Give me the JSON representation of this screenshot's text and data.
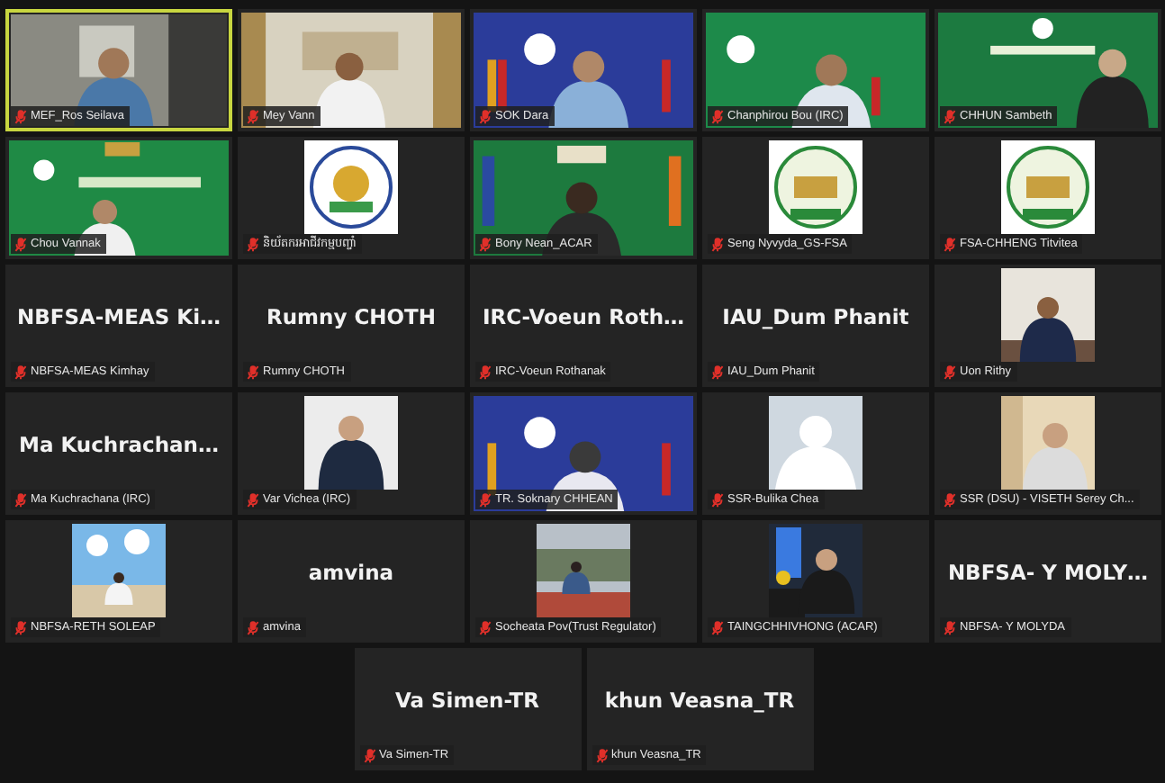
{
  "tiles": [
    {
      "kind": "video",
      "name": "MEF_Ros Seilava",
      "speaking": true,
      "muted": true
    },
    {
      "kind": "video",
      "name": "Mey Vann",
      "speaking": false,
      "muted": true
    },
    {
      "kind": "video",
      "name": "SOK Dara",
      "speaking": false,
      "muted": true
    },
    {
      "kind": "video",
      "name": "Chanphirou Bou (IRC)",
      "speaking": false,
      "muted": true
    },
    {
      "kind": "video",
      "name": "CHHUN Sambeth",
      "speaking": false,
      "muted": true
    },
    {
      "kind": "video",
      "name": "Chou Vannak",
      "speaking": false,
      "muted": true
    },
    {
      "name": "និយ័តករអាជីវកម្មបញ្ចាំ",
      "speaking": false,
      "muted": true
    },
    {
      "kind": "video",
      "name": "Bony Nean_ACAR",
      "speaking": false,
      "muted": true
    },
    {
      "name": "Seng Nyvyda_GS-FSA",
      "speaking": false,
      "muted": true
    },
    {
      "name": "FSA-CHHENG Titvitea",
      "speaking": false,
      "muted": true
    },
    {
      "kind": "name",
      "display_name": "NBFSA-MEAS  Ki…",
      "name": "NBFSA-MEAS Kimhay",
      "speaking": false,
      "muted": true
    },
    {
      "kind": "name",
      "display_name": "Rumny CHOTH",
      "name": "Rumny CHOTH",
      "speaking": false,
      "muted": true
    },
    {
      "kind": "name",
      "display_name": "IRC-Voeun  Roth…",
      "name": "IRC-Voeun Rothanak",
      "speaking": false,
      "muted": true
    },
    {
      "kind": "name",
      "display_name": "IAU_Dum Phanit",
      "name": "IAU_Dum Phanit",
      "speaking": false,
      "muted": true
    },
    {
      "name": "Uon Rithy",
      "speaking": false,
      "muted": true
    },
    {
      "kind": "name",
      "display_name": "Ma  Kuchrachan…",
      "name": "Ma Kuchrachana (IRC)",
      "speaking": false,
      "muted": true
    },
    {
      "name": "Var Vichea (IRC)",
      "speaking": false,
      "muted": true
    },
    {
      "kind": "video",
      "name": "TR. Soknary CHHEAN",
      "speaking": false,
      "muted": true
    },
    {
      "name": "SSR-Bulika Chea",
      "speaking": false,
      "muted": true
    },
    {
      "name": "SSR (DSU) - VISETH Serey Ch...",
      "speaking": false,
      "muted": true
    },
    {
      "name": "NBFSA-RETH SOLEAP",
      "speaking": false,
      "muted": true
    },
    {
      "kind": "name",
      "display_name": "amvina",
      "name": "amvina",
      "speaking": false,
      "muted": true
    },
    {
      "name": "Socheata Pov(Trust Regulator)",
      "speaking": false,
      "muted": true
    },
    {
      "name": "TAINGCHHIVHONG (ACAR)",
      "speaking": false,
      "muted": true
    },
    {
      "kind": "name",
      "display_name": "NBFSA- Y MOLY…",
      "name": "NBFSA- Y MOLYDA",
      "speaking": false,
      "muted": true
    },
    {
      "kind": "name",
      "display_name": "Va Simen-TR",
      "name": "Va Simen-TR",
      "speaking": false,
      "muted": true
    },
    {
      "kind": "name",
      "display_name": "khun Veasna_TR",
      "name": "khun Veasna_TR",
      "speaking": false,
      "muted": true
    }
  ]
}
